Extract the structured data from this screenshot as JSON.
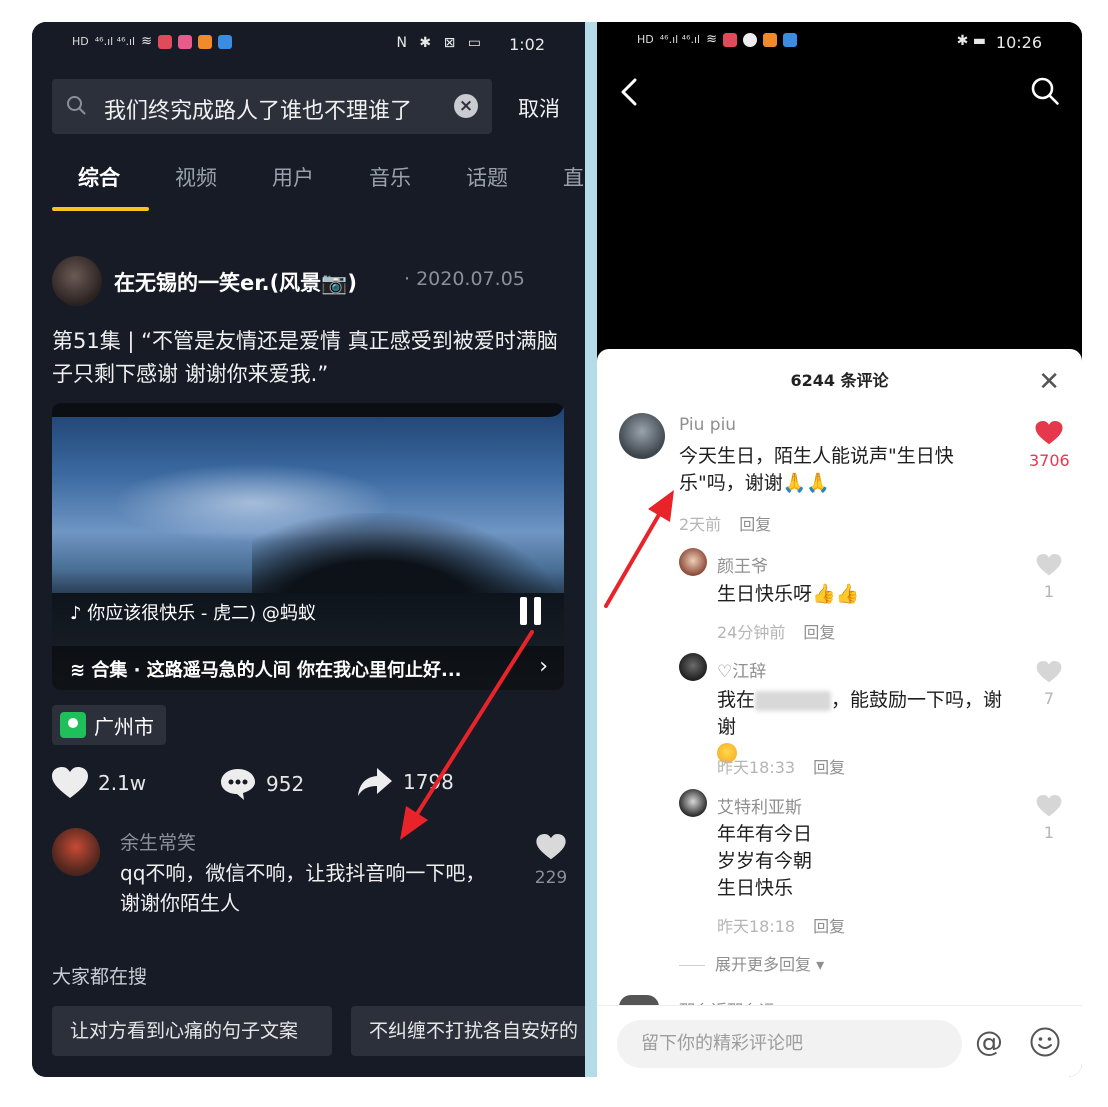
{
  "left": {
    "status": {
      "time": "1:02",
      "sys_icons": "N ✱ ⊠ ▭"
    },
    "search": {
      "query": "我们终究成路人了谁也不理谁了",
      "cancel_label": "取消"
    },
    "tabs": [
      {
        "label": "综合",
        "active": true
      },
      {
        "label": "视频"
      },
      {
        "label": "用户"
      },
      {
        "label": "音乐"
      },
      {
        "label": "话题"
      },
      {
        "label": "直"
      }
    ],
    "post": {
      "author": "在无锡的一笑er.(风景📷)",
      "date": "· 2020.07.05",
      "description": "第51集 | “不管是友情还是爱情 真正感受到被爱时满脑子只剩下感谢 谢谢你来爱我.”",
      "music": "♪  你应该很快乐 - 虎二)   @蚂蚁",
      "collection": "≋ 合集 · 这路遥马急的人间 你在我心里何止好...",
      "location": "广州市",
      "likes": "2.1w",
      "comments": "952",
      "shares": "1798"
    },
    "top_comment": {
      "name": "余生常笑",
      "text": "qq不响，微信不响，让我抖音响一下吧，谢谢你陌生人",
      "likes": "229"
    },
    "hot_title": "大家都在搜",
    "hot_chips": [
      "让对方看到心痛的句子文案",
      "不纠缠不打扰各自安好的"
    ]
  },
  "right": {
    "status": {
      "time": "10:26",
      "sys_icons": "✱ ▬"
    },
    "comment_count": "6244 条评论",
    "comments": [
      {
        "name": "Piu piu",
        "text": "今天生日，陌生人能说声\"生日快乐\"吗，谢谢🙏🙏",
        "time": "2天前",
        "reply": "回复",
        "likes": "3706"
      },
      {
        "name": "颜王爷",
        "text": "生日快乐呀👍👍",
        "time": "24分钟前",
        "reply": "回复",
        "likes": "1"
      },
      {
        "name": "♡江辞",
        "text_a": "我在",
        "text_b": "，能鼓励一下吗，谢谢",
        "time": "昨天18:33",
        "reply": "回复",
        "likes": "7"
      },
      {
        "name": "艾特利亚斯",
        "lines": [
          "年年有今日",
          "岁岁有今朝",
          "生日快乐"
        ],
        "time": "昨天18:18",
        "reply": "回复",
        "likes": "1"
      }
    ],
    "more_replies": "展开更多回复 ▾",
    "next_name": "那么近那么远",
    "input_placeholder": "留下你的精彩评论吧",
    "at_symbol": "@"
  },
  "colors": {
    "left_bg": "#161b26",
    "tab_underline": "#f6c41f",
    "like_red": "#e5384d",
    "arrow_red": "#e8232a",
    "location_green": "#1fbf5a"
  }
}
